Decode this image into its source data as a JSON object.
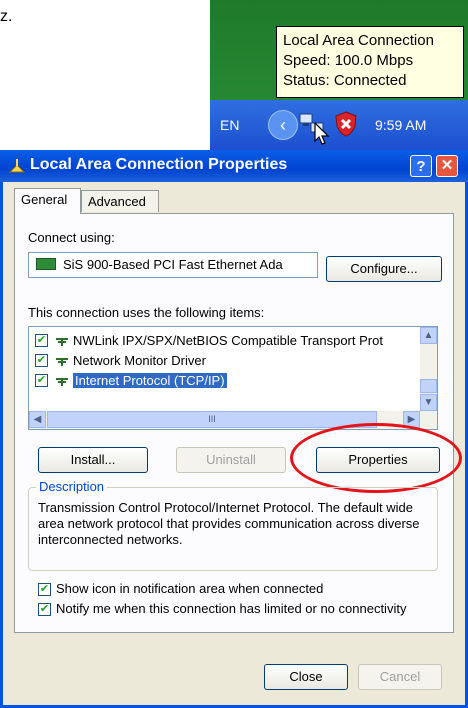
{
  "clip_text": "z.",
  "taskbar": {
    "language": "EN",
    "time": "9:59 AM",
    "chevron": "‹"
  },
  "tooltip": {
    "title": "Local Area Connection",
    "speed": "Speed: 100.0 Mbps",
    "status": "Status: Connected"
  },
  "dialog": {
    "title": "Local Area Connection Properties",
    "help_glyph": "?",
    "close_glyph": "✕",
    "tabs": [
      "General",
      "Advanced"
    ],
    "connect_using_label": "Connect using:",
    "adapter": "SiS 900-Based PCI Fast Ethernet Ada",
    "configure_label": "Configure...",
    "items_label": "This connection uses the following items:",
    "items": [
      {
        "label": "NWLink IPX/SPX/NetBIOS Compatible Transport Prot",
        "checked": true,
        "selected": false
      },
      {
        "label": "Network Monitor Driver",
        "checked": true,
        "selected": false
      },
      {
        "label": "Internet Protocol (TCP/IP)",
        "checked": true,
        "selected": true
      }
    ],
    "hscroll_thumb_glyph": "III",
    "install_label": "Install...",
    "uninstall_label": "Uninstall",
    "properties_label": "Properties",
    "description_title": "Description",
    "description_text": "Transmission Control Protocol/Internet Protocol. The default wide area network protocol that provides communication across diverse interconnected networks.",
    "show_icon_label": "Show icon in notification area when connected",
    "notify_label": "Notify me when this connection has limited or no connectivity",
    "close_label": "Close",
    "cancel_label": "Cancel"
  },
  "colors": {
    "title_bar": "#0043d0",
    "highlight": "#e5141b",
    "selection": "#316ac5"
  }
}
